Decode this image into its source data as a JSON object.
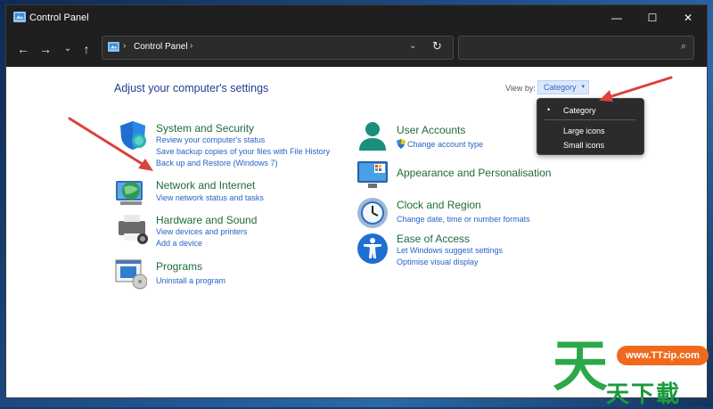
{
  "window": {
    "title": "Control Panel",
    "controls": {
      "minimize": "—",
      "maximize": "☐",
      "close": "✕"
    }
  },
  "toolbar": {
    "back": "←",
    "forward": "→",
    "recent": "⌄",
    "up": "↑",
    "address": {
      "sep": "›",
      "path": "Control Panel",
      "dropdown": "⌄",
      "refresh": "↻"
    },
    "search": {
      "placeholder": "",
      "icon": "⌕"
    }
  },
  "content": {
    "heading": "Adjust your computer's settings",
    "view_by": {
      "label": "View by:",
      "selected": "Category",
      "caret": "▾",
      "options": [
        "Category",
        "Large icons",
        "Small icons"
      ],
      "bullet": "•"
    },
    "categories_left": [
      {
        "title": "System and Security",
        "icon": "shield-icon",
        "links": [
          "Review your computer's status",
          "Save backup copies of your files with File History",
          "Back up and Restore (Windows 7)"
        ]
      },
      {
        "title": "Network and Internet",
        "icon": "network-icon",
        "links": [
          "View network status and tasks"
        ]
      },
      {
        "title": "Hardware and Sound",
        "icon": "printer-icon",
        "links": [
          "View devices and printers",
          "Add a device"
        ]
      },
      {
        "title": "Programs",
        "icon": "programs-icon",
        "links": [
          "Uninstall a program"
        ]
      }
    ],
    "categories_right": [
      {
        "title": "User Accounts",
        "icon": "user-icon",
        "links": [
          "Change account type"
        ]
      },
      {
        "title": "Appearance and Personalisation",
        "icon": "monitor-icon",
        "links": []
      },
      {
        "title": "Clock and Region",
        "icon": "clock-icon",
        "links": [
          "Change date, time or number formats"
        ]
      },
      {
        "title": "Ease of Access",
        "icon": "accessibility-icon",
        "links": [
          "Let Windows suggest settings",
          "Optimise visual display"
        ]
      }
    ]
  },
  "watermark": {
    "url": "www.TTzip.com",
    "glyph": "天",
    "text": "天下載"
  },
  "colors": {
    "link": "#2563c9",
    "category_title": "#1d6b3b",
    "heading": "#1e3f8a",
    "arrow": "#d9423f",
    "titlebar": "#1f1f1f"
  }
}
